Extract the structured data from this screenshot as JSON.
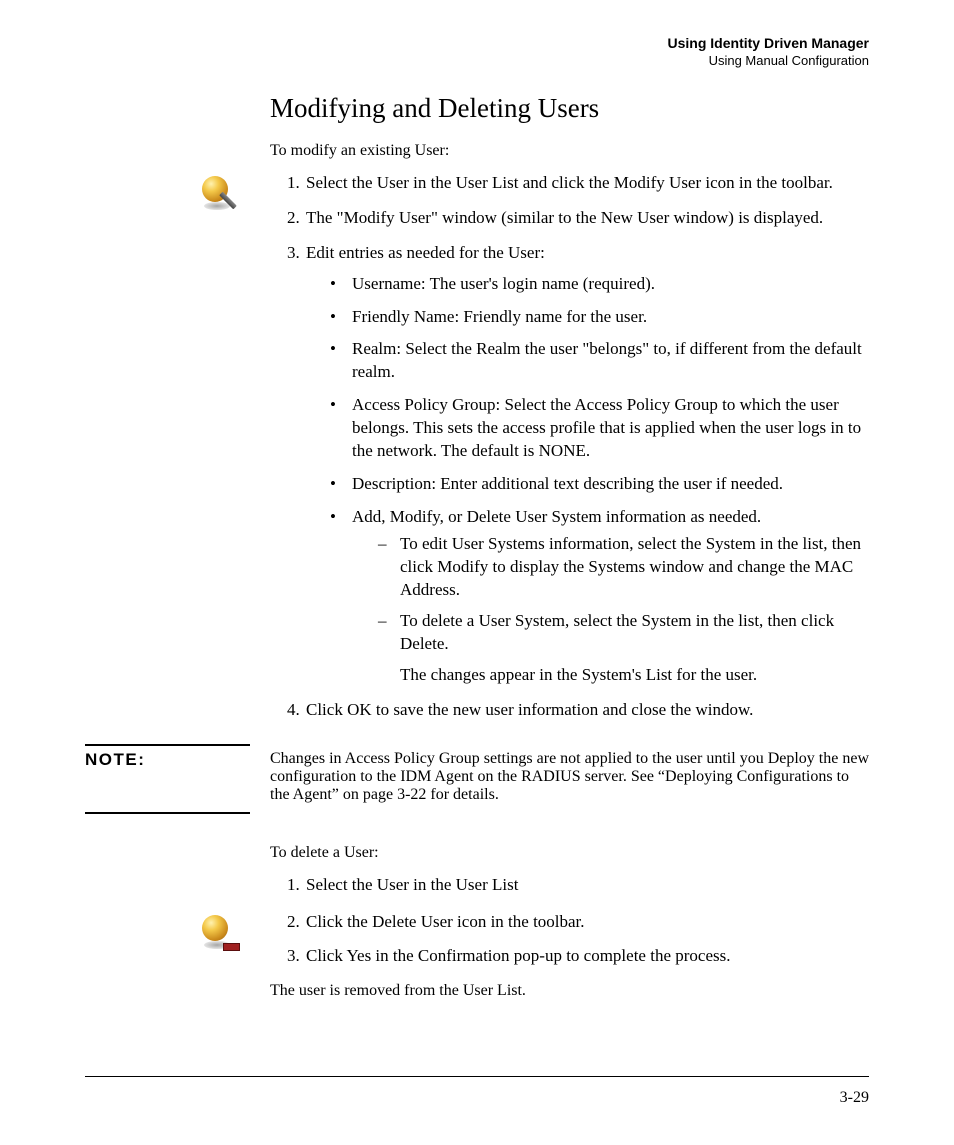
{
  "header": {
    "line1": "Using Identity Driven Manager",
    "line2": "Using Manual Configuration"
  },
  "title": "Modifying and Deleting Users",
  "modify_intro": "To modify an existing User:",
  "modify_steps": {
    "s1": "Select the User in the User List and click the Modify User icon in the toolbar.",
    "s2": "The \"Modify User\" window (similar to the New User window) is displayed.",
    "s3": "Edit entries as needed for the User:",
    "s4": "Click OK to save the new user information and close the window."
  },
  "bullets": {
    "b1": "Username: The user's login name (required).",
    "b2": "Friendly Name: Friendly name for the user.",
    "b3": "Realm: Select the Realm the user \"belongs\" to, if different from the default realm.",
    "b4": "Access Policy Group: Select the Access Policy Group to which the user belongs. This sets the access profile that is applied when the user logs in to the network. The default is NONE.",
    "b5": "Description: Enter additional text describing the user if needed.",
    "b6": "Add, Modify, or Delete User System information as needed."
  },
  "dashes": {
    "d1": "To edit User Systems information, select the System in the list, then click Modify to display the Systems window and change the MAC Address.",
    "d2": "To delete a User System, select the System in the list, then click Delete.",
    "tail": "The changes appear in the System's List for the user."
  },
  "note": {
    "label": "NOTE:",
    "body": "Changes in Access Policy Group settings are not applied to the user until you Deploy the new configuration to the IDM Agent on the RADIUS server. See “Deploying Configurations to the Agent” on page 3-22 for details."
  },
  "delete_intro": "To delete a User:",
  "delete_steps": {
    "s1": "Select the User in the User List",
    "s2": "Click the Delete User icon in the toolbar.",
    "s3": "Click Yes in the Confirmation pop-up to complete the process."
  },
  "delete_outro": "The user is removed from the User List.",
  "page_number": "3-29"
}
